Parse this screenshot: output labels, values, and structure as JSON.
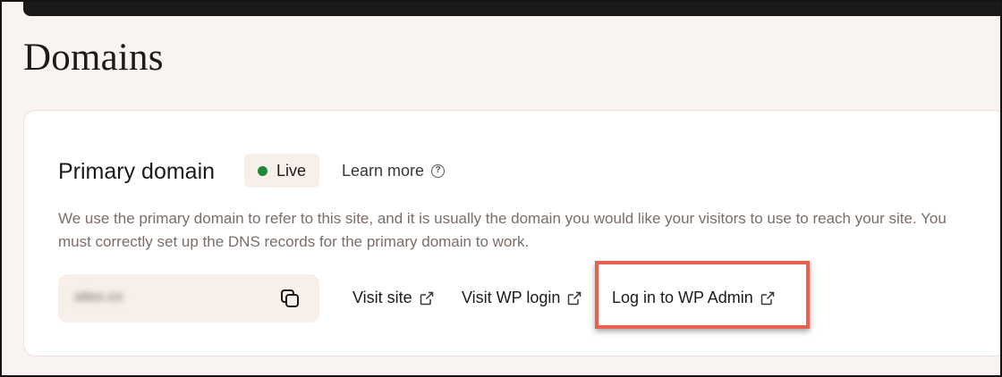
{
  "page": {
    "title": "Domains"
  },
  "primary_domain": {
    "title": "Primary domain",
    "status_label": "Live",
    "status_color": "#1f8a3a",
    "learn_more_label": "Learn more",
    "learn_more_icon": "help-circle-icon",
    "description": "We use the primary domain to refer to this site, and it is usually the domain you would like your visitors to use to reach your site. You must correctly set up the DNS records for the primary domain to work.",
    "domain_value": "sitex.co",
    "copy_icon": "copy-icon"
  },
  "links": {
    "visit_site": "Visit site",
    "visit_wp_login": "Visit WP login",
    "log_in_wp_admin": "Log in to WP Admin",
    "link_icon": "external-link-icon"
  },
  "highlight_color": "#e8604f"
}
